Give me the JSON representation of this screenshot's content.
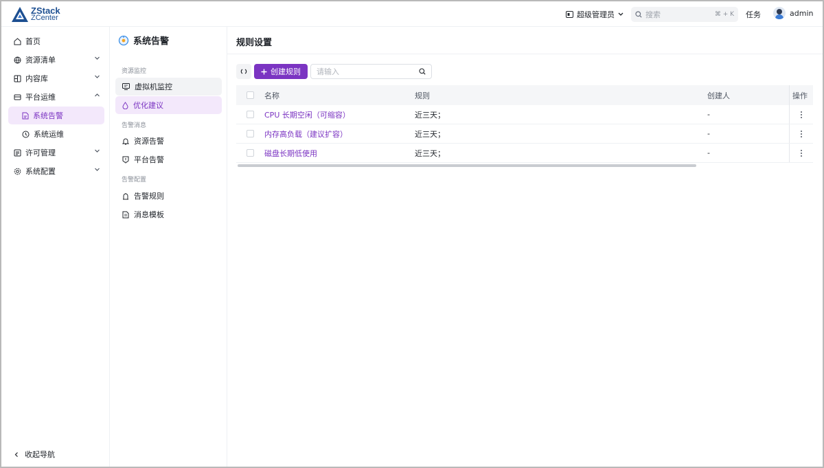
{
  "brand": {
    "line1": "ZStack",
    "line2": "ZCenter"
  },
  "header": {
    "role_label": "超级管理员",
    "search_placeholder": "搜索",
    "search_shortcut": "⌘ + K",
    "tasks_label": "任务",
    "user_name": "admin"
  },
  "nav": {
    "items": [
      {
        "label": "首页",
        "icon": "home-icon",
        "expandable": false
      },
      {
        "label": "资源清单",
        "icon": "globe-icon",
        "expandable": true
      },
      {
        "label": "内容库",
        "icon": "library-icon",
        "expandable": true
      },
      {
        "label": "平台运维",
        "icon": "ops-icon",
        "expandable": true,
        "expanded": true
      },
      {
        "label": "系统告警",
        "icon": "doc-alert-icon",
        "sub": true,
        "active": true
      },
      {
        "label": "系统运维",
        "icon": "clock-icon",
        "sub": true
      },
      {
        "label": "许可管理",
        "icon": "license-icon",
        "expandable": true
      },
      {
        "label": "系统配置",
        "icon": "settings-icon",
        "expandable": true
      }
    ],
    "collapse_label": "收起导航"
  },
  "panel": {
    "title": "系统告警",
    "groups": [
      {
        "label": "资源监控",
        "items": [
          {
            "label": "虚拟机监控",
            "icon": "monitor-icon"
          },
          {
            "label": "优化建议",
            "icon": "drop-icon",
            "active": true
          }
        ]
      },
      {
        "label": "告警消息",
        "items": [
          {
            "label": "资源告警",
            "icon": "bell-icon"
          },
          {
            "label": "平台告警",
            "icon": "shield-alert-icon"
          }
        ]
      },
      {
        "label": "告警配置",
        "items": [
          {
            "label": "告警规则",
            "icon": "alarm-icon"
          },
          {
            "label": "消息模板",
            "icon": "template-icon"
          }
        ]
      }
    ]
  },
  "main": {
    "title": "规则设置",
    "create_label": "创建规则",
    "search_placeholder": "请输入",
    "columns": {
      "name": "名称",
      "rule": "规则",
      "creator": "创建人",
      "actions": "操作"
    },
    "rows": [
      {
        "name": "CPU 长期空闲（可缩容）",
        "rule": "近三天；",
        "creator": "-"
      },
      {
        "name": "内存高负载（建议扩容）",
        "rule": "近三天；",
        "creator": "-"
      },
      {
        "name": "磁盘长期低使用",
        "rule": "近三天；",
        "creator": "-"
      }
    ]
  },
  "colors": {
    "accent": "#7b34c2",
    "accent_bg": "#f3e8fb",
    "brand_blue": "#1d4f91"
  }
}
